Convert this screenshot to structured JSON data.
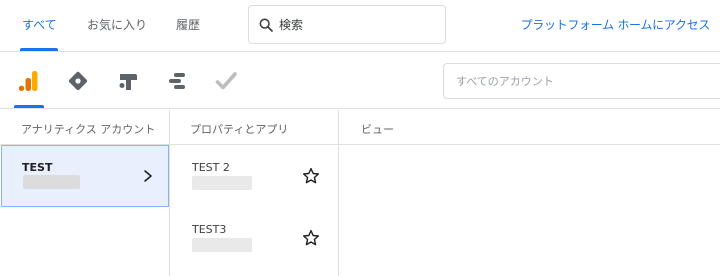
{
  "tabs": [
    {
      "label": "すべて",
      "active": true
    },
    {
      "label": "お気に入り",
      "active": false
    },
    {
      "label": "履歴",
      "active": false
    }
  ],
  "search": {
    "placeholder": "検索",
    "icon": "search-icon"
  },
  "platform_link": "プラットフォーム ホームにアクセス",
  "products": [
    {
      "icon": "analytics-icon",
      "active": true
    },
    {
      "icon": "tag-manager-icon",
      "active": false
    },
    {
      "icon": "optimize-icon",
      "active": false
    },
    {
      "icon": "data-studio-icon",
      "active": false
    },
    {
      "icon": "surveys-icon",
      "active": false
    }
  ],
  "account_filter": {
    "placeholder": "すべてのアカウント"
  },
  "columns": {
    "accounts": "アナリティクス アカウント",
    "properties": "プロパティとアプリ",
    "views": "ビュー"
  },
  "accounts": [
    {
      "name": "TEST",
      "selected": true
    }
  ],
  "properties": [
    {
      "name": "TEST 2",
      "starred": false
    },
    {
      "name": "TEST3",
      "starred": false
    }
  ],
  "colors": {
    "accent": "#1a73e8",
    "analytics_orange": "#f9ab00",
    "analytics_dark": "#e37400",
    "selected_bg": "#e8f0fe",
    "icon_gray": "#5f6368"
  }
}
